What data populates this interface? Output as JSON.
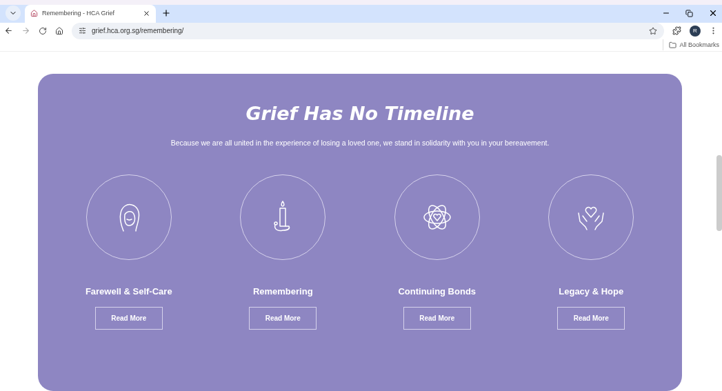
{
  "browser": {
    "tab": {
      "title": "Remembering - HCA Grief",
      "selected": true
    },
    "url": "grief.hca.org.sg/remembering/",
    "profile": "R",
    "bookmarks": "All Bookmarks"
  },
  "hero": {
    "title": "Grief Has No Timeline",
    "subtitle": "Because we are all united in the experience of losing a loved one, we stand in solidarity with you in your bereavement.",
    "cards": [
      {
        "kind": "face",
        "label": "Farewell & Self-Care",
        "button": "Read More"
      },
      {
        "kind": "candle",
        "label": "Remembering",
        "button": "Read More"
      },
      {
        "kind": "atom",
        "label": "Continuing Bonds",
        "button": "Read More"
      },
      {
        "kind": "hands",
        "label": "Legacy & Hope",
        "button": "Read More"
      }
    ]
  }
}
